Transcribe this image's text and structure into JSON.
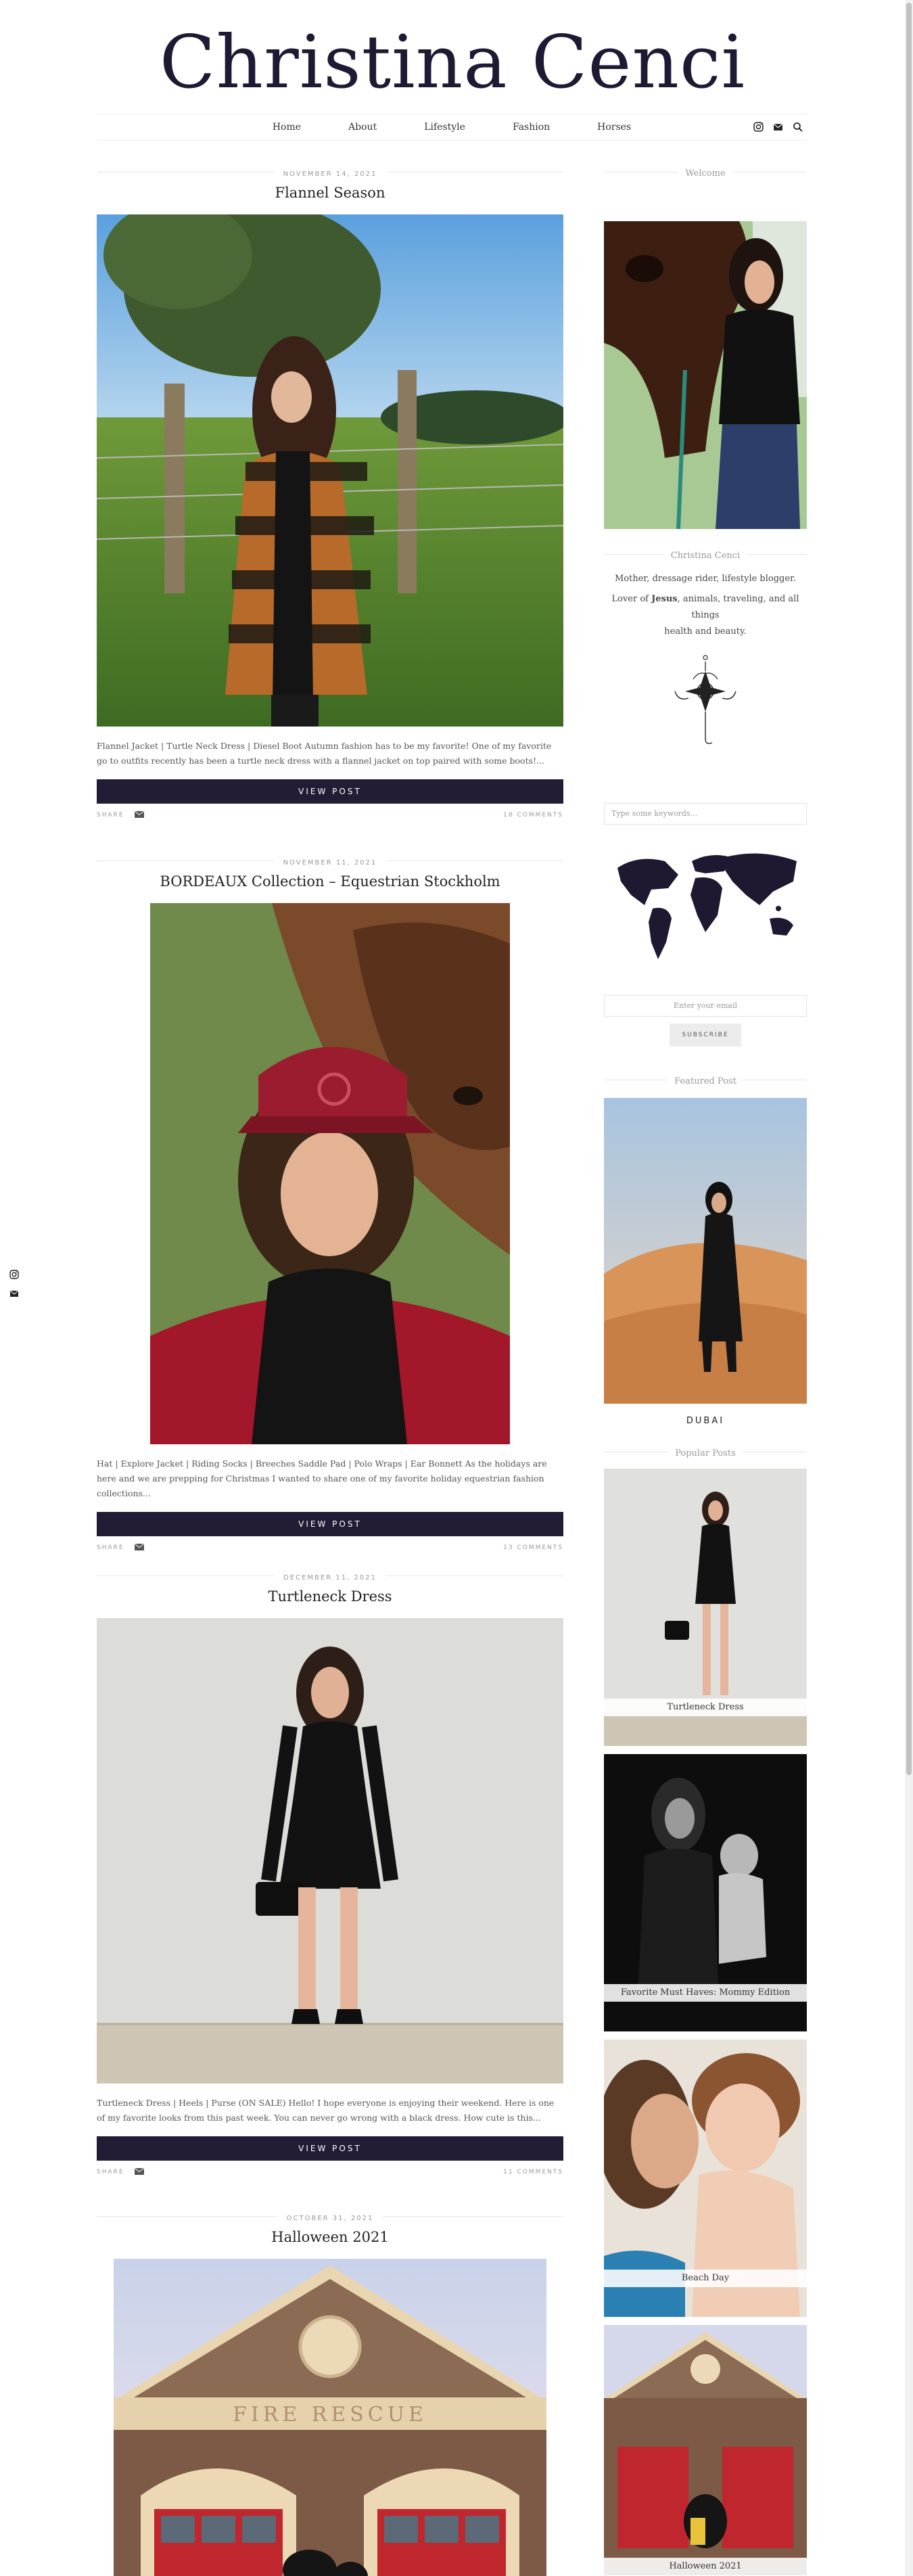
{
  "site": {
    "title": "Christina Cenci"
  },
  "nav": {
    "items": [
      "Home",
      "About",
      "Lifestyle",
      "Fashion",
      "Horses"
    ],
    "icons": [
      "instagram-icon",
      "envelope-icon",
      "search-icon"
    ]
  },
  "posts": [
    {
      "date": "NOVEMBER 14, 2021",
      "title": "Flannel Season",
      "excerpt": "Flannel Jacket | Turtle Neck Dress | Diesel Boot Autumn fashion has to be my favorite! One of my favorite go to outfits recently has been a turtle neck dress with a flannel jacket on top paired with some boots!...",
      "button": "VIEW POST",
      "share": "SHARE",
      "comments": "18 COMMENTS"
    },
    {
      "date": "NOVEMBER 11, 2021",
      "title": "BORDEAUX Collection – Equestrian Stockholm",
      "excerpt": "Hat | Explore Jacket | Riding Socks | Breeches Saddle Pad | Polo Wraps | Ear Bonnett As the holidays are here and we are prepping for Christmas I wanted to share one of my favorite holiday equestrian fashion collections...",
      "button": "VIEW POST",
      "share": "SHARE",
      "comments": "13 COMMENTS"
    },
    {
      "date": "DECEMBER 11, 2021",
      "title": "Turtleneck Dress",
      "excerpt": "Turtleneck Dress | Heels | Purse (ON SALE) Hello! I hope everyone is enjoying their weekend. Here is one of my favorite looks from this past week. You can never go wrong with a black dress. How cute is this...",
      "button": "VIEW POST",
      "share": "SHARE",
      "comments": "11 COMMENTS"
    },
    {
      "date": "OCTOBER 31, 2021",
      "title": "Halloween 2021",
      "sign_text": "FIRE RESCUE"
    }
  ],
  "sidebar": {
    "welcome": {
      "title": "Welcome",
      "name": "Christina Cenci",
      "line1": "Mother, dressage rider, lifestyle blogger.",
      "line2_pre": "Lover of ",
      "line2_bold": "Jesus",
      "line2_post": ", animals, traveling, and all things",
      "line3": "health and beauty."
    },
    "search": {
      "placeholder": "Type some keywords..."
    },
    "subscribe": {
      "placeholder": "Enter your email",
      "button": "SUBSCRIBE"
    },
    "featured": {
      "title": "Featured Post",
      "caption": "DUBAI"
    },
    "popular": {
      "title": "Popular Posts",
      "items": [
        "Turtleneck Dress",
        "Favorite Must Haves: Mommy Edition",
        "Beach Day",
        "Halloween 2021"
      ]
    }
  },
  "colors": {
    "brand_dark": "#221c35",
    "title": "#1e1a33"
  }
}
